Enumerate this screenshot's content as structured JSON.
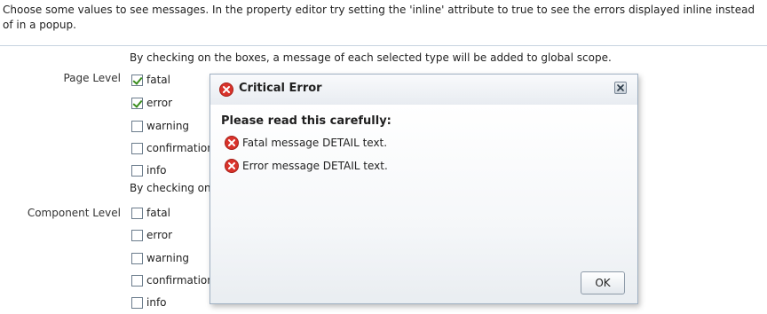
{
  "intro": "Choose some values to see messages. In the property editor try setting the 'inline' attribute to true to see the errors displayed inline instead of in a popup.",
  "page_level": {
    "description": "By checking on the boxes, a message of each selected type will be added to global scope.",
    "label": "Page Level",
    "options": [
      {
        "label": "fatal",
        "checked": true
      },
      {
        "label": "error",
        "checked": true
      },
      {
        "label": "warning",
        "checked": false
      },
      {
        "label": "confirmation",
        "checked": false
      },
      {
        "label": "info",
        "checked": false
      }
    ]
  },
  "component_level": {
    "description": "By checking on the boxes, a message of each selected type will be added to this component.",
    "label": "Component Level",
    "options": [
      {
        "label": "fatal",
        "checked": false
      },
      {
        "label": "error",
        "checked": false
      },
      {
        "label": "warning",
        "checked": false
      },
      {
        "label": "confirmation",
        "checked": false
      },
      {
        "label": "info",
        "checked": false
      }
    ]
  },
  "dialog": {
    "title": "Critical Error",
    "heading": "Please read this carefully:",
    "messages": [
      "Fatal message DETAIL text.",
      "Error message DETAIL text."
    ],
    "ok_label": "OK",
    "title_icon": "error-icon",
    "close_icon": "close-icon"
  },
  "colors": {
    "error_red": "#d9332b",
    "check_green": "#3a8d1e",
    "divider": "#c7d3df"
  }
}
